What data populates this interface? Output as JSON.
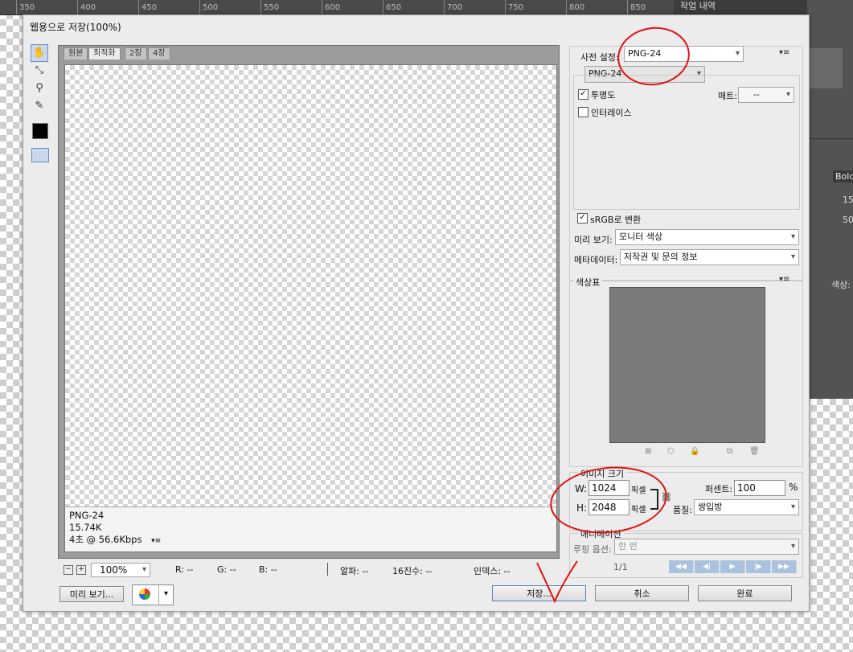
{
  "ruler": {
    "ticks": [
      "350",
      "400",
      "450",
      "500",
      "550",
      "600",
      "650",
      "700",
      "750",
      "800",
      "850"
    ]
  },
  "history_panel": {
    "title": "작업 내역"
  },
  "dialog": {
    "title": "웹용으로 저장(100%)",
    "tabs": [
      "원본",
      "최적화",
      "2장",
      "4장"
    ],
    "tools": [
      "hand-icon",
      "slice-select-icon",
      "zoom-icon",
      "eyedropper-icon"
    ],
    "info": {
      "format": "PNG-24",
      "size": "15.74K",
      "speed": "4초 @ 56.6Kbps"
    },
    "status": {
      "zoom": "100%",
      "r": "R: --",
      "g": "G: --",
      "b": "B: --",
      "alpha": "알파: --",
      "hex": "16진수: --",
      "index": "인덱스: --"
    },
    "preview_button": "미리 보기...",
    "buttons": {
      "save": "저장...",
      "cancel": "취소",
      "done": "완료"
    }
  },
  "settings": {
    "preset_label": "사전 설정:",
    "preset_value": "PNG-24",
    "format_value": "PNG-24",
    "transparency_label": "투명도",
    "transparency_checked": true,
    "matte_label": "매트:",
    "matte_value": "--",
    "interlace_label": "인터레이스",
    "interlace_checked": false,
    "srgb_label": "sRGB로 변환",
    "srgb_checked": true,
    "preview_label": "미리 보기:",
    "preview_value": "모니터 색상",
    "metadata_label": "메타데이터:",
    "metadata_value": "저작권 및 문의 정보"
  },
  "color_table": {
    "title": "색상표"
  },
  "image_size": {
    "title": "이미지 크기",
    "w_label": "W:",
    "w_value": "1024",
    "h_label": "H:",
    "h_value": "2048",
    "unit": "픽셀",
    "percent_label": "퍼센트:",
    "percent_value": "100",
    "percent_unit": "%",
    "quality_label": "품질:",
    "quality_value": "쌍입방"
  },
  "animation": {
    "title": "애니메이션",
    "loop_label": "루핑 옵션:",
    "loop_value": "한 번",
    "frame": "1/1"
  },
  "right_bg": {
    "bold": "Bold",
    "n1": "15",
    "n2": "50",
    "color": "색상:"
  },
  "accent": "#e01010"
}
